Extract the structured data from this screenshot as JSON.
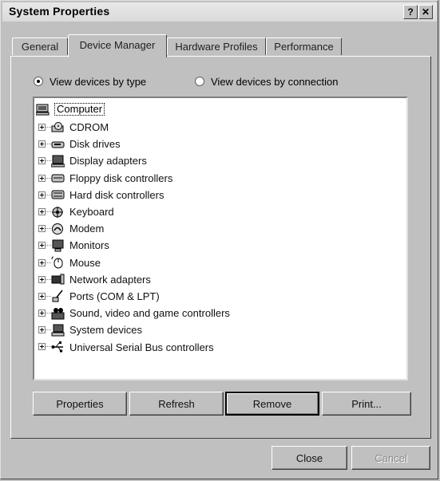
{
  "window": {
    "title": "System Properties",
    "help_label": "?",
    "close_label": "✕"
  },
  "tabs": [
    {
      "label": "General",
      "active": false
    },
    {
      "label": "Device Manager",
      "active": true
    },
    {
      "label": "Hardware Profiles",
      "active": false
    },
    {
      "label": "Performance",
      "active": false
    }
  ],
  "view_options": {
    "by_type": {
      "label": "View devices by type",
      "checked": true
    },
    "by_connection": {
      "label": "View devices by connection",
      "checked": false
    }
  },
  "tree": {
    "root": {
      "label": "Computer",
      "icon": "computer-icon"
    },
    "items": [
      {
        "label": "CDROM",
        "icon": "cdrom-icon"
      },
      {
        "label": "Disk drives",
        "icon": "disk-drive-icon"
      },
      {
        "label": "Display adapters",
        "icon": "display-adapter-icon"
      },
      {
        "label": "Floppy disk controllers",
        "icon": "floppy-controller-icon"
      },
      {
        "label": "Hard disk controllers",
        "icon": "hard-disk-controller-icon"
      },
      {
        "label": "Keyboard",
        "icon": "keyboard-icon"
      },
      {
        "label": "Modem",
        "icon": "modem-icon"
      },
      {
        "label": "Monitors",
        "icon": "monitor-icon"
      },
      {
        "label": "Mouse",
        "icon": "mouse-icon"
      },
      {
        "label": "Network adapters",
        "icon": "network-adapter-icon"
      },
      {
        "label": "Ports (COM & LPT)",
        "icon": "port-icon"
      },
      {
        "label": "Sound, video and game controllers",
        "icon": "sound-video-icon"
      },
      {
        "label": "System devices",
        "icon": "system-device-icon"
      },
      {
        "label": "Universal Serial Bus controllers",
        "icon": "usb-icon"
      }
    ]
  },
  "buttons": {
    "properties": "Properties",
    "refresh": "Refresh",
    "remove": "Remove",
    "print": "Print...",
    "close": "Close",
    "cancel": "Cancel"
  }
}
